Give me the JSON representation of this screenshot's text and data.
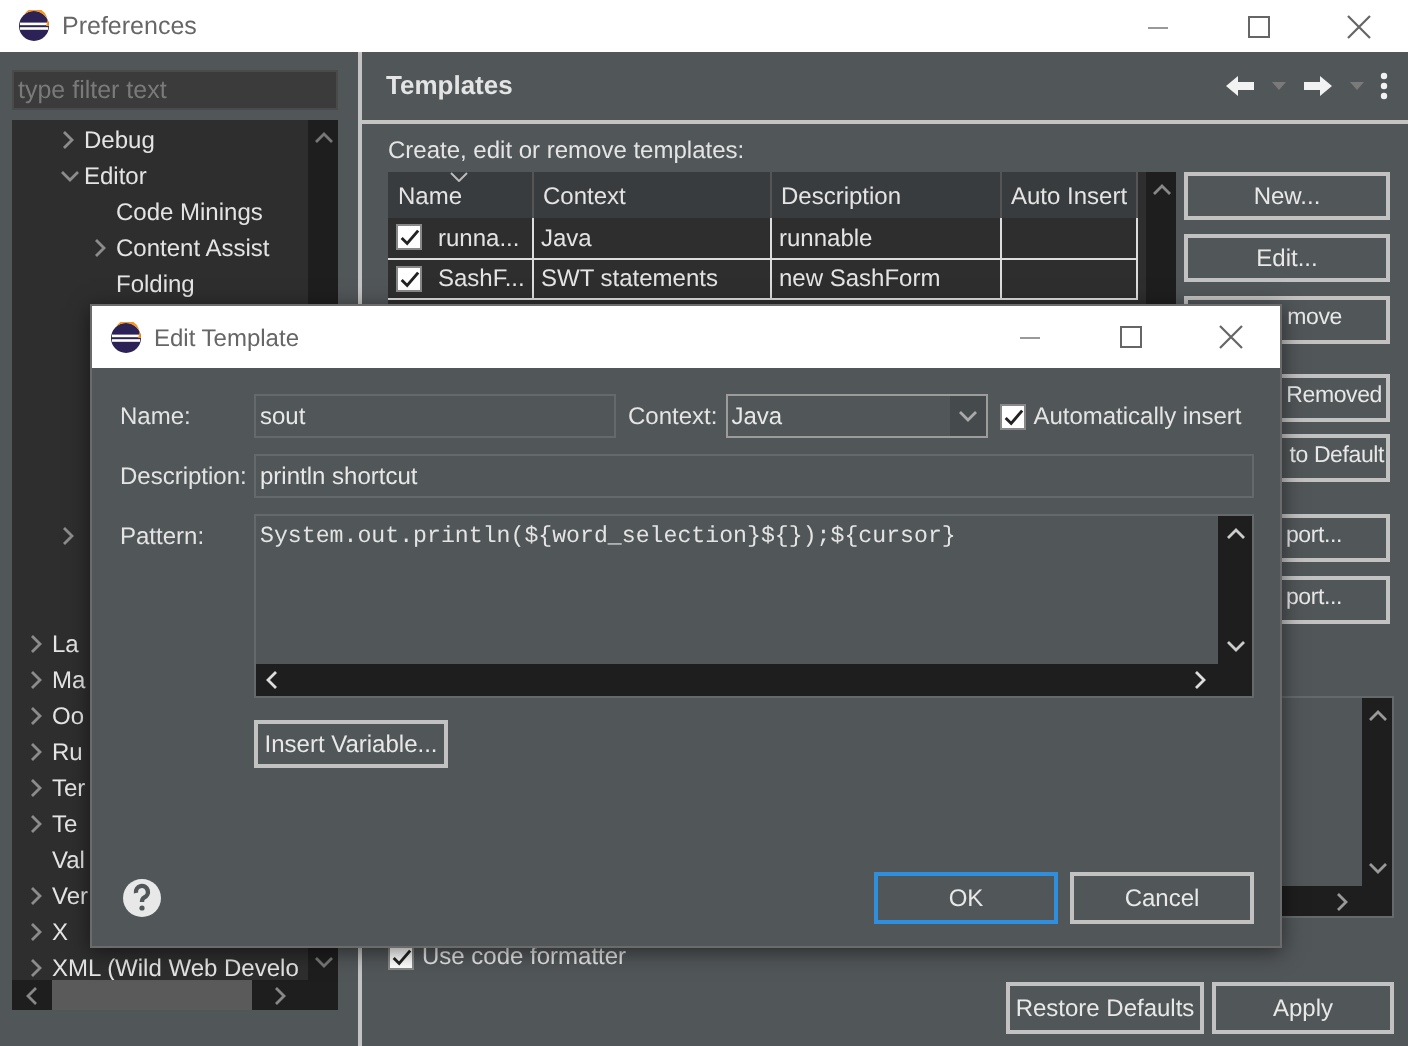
{
  "window": {
    "title": "Preferences"
  },
  "filter": {
    "placeholder": "type filter text"
  },
  "tree": [
    {
      "children": [
        {
          "label": "Debug",
          "expanded": false
        },
        {
          "label": "Editor",
          "expanded": true,
          "children": [
            {
              "label": "Code Minings"
            },
            {
              "label": "Content Assist",
              "expanded": false
            },
            {
              "label": "Folding"
            }
          ]
        },
        {
          "expanded": false
        }
      ]
    },
    {
      "label": "La",
      "expanded": false
    },
    {
      "label": "Ma",
      "expanded": false
    },
    {
      "label": "Oo",
      "expanded": false
    },
    {
      "label": "Ru",
      "expanded": false
    },
    {
      "label": "Ter",
      "expanded": false
    },
    {
      "label": "Te",
      "expanded": false
    },
    {
      "label": "Val"
    },
    {
      "label": "Ver",
      "expanded": false
    },
    {
      "label": "X",
      "expanded": false
    },
    {
      "label": "XML (Wild Web Develo",
      "expanded": false
    }
  ],
  "panel": {
    "title": "Templates",
    "intro": "Create, edit or remove templates:",
    "table": {
      "columns": [
        {
          "label": "Name",
          "sorted": true
        },
        {
          "label": "Context",
          "sorted": false
        },
        {
          "label": "Description",
          "sorted": false
        },
        {
          "label": "Auto Insert",
          "sorted": false
        }
      ],
      "rows": [
        {
          "checked": true,
          "name": "runna...",
          "context": "Java",
          "description": "runnable"
        },
        {
          "checked": true,
          "name": "SashF...",
          "context": "SWT statements",
          "description": "new SashForm"
        }
      ]
    },
    "buttons": [
      "New...",
      "Edit...",
      "move",
      "Removed",
      "to Default",
      "port...",
      "port..."
    ],
    "use_code_formatter": {
      "label": "Use code formatter",
      "checked": true
    },
    "footer_buttons": [
      "Restore Defaults",
      "Apply"
    ]
  },
  "dialog": {
    "title": "Edit Template",
    "name_label": "Name:",
    "name": "sout",
    "context_label": "Context:",
    "context": "Java",
    "auto_insert": {
      "label": "Automatically insert",
      "checked": true
    },
    "description_label": "Description:",
    "description": "println shortcut",
    "pattern_label": "Pattern:",
    "pattern": "System.out.println(${word_selection}${});${cursor}",
    "insert_variable": "Insert Variable...",
    "ok": "OK",
    "cancel": "Cancel"
  }
}
